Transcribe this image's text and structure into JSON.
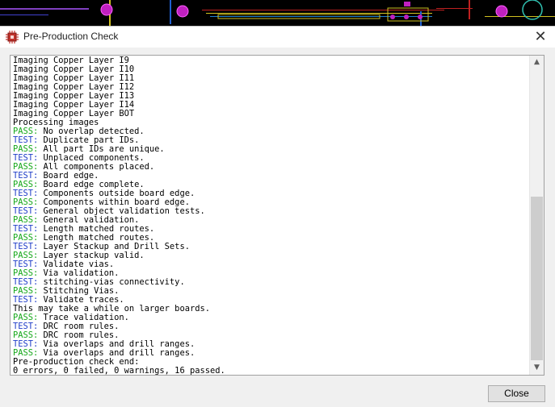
{
  "dialog": {
    "title": "Pre-Production Check",
    "close_button": "Close"
  },
  "colors": {
    "pass": "#16a81a",
    "test": "#1e3cc8",
    "pcb_background": "#000000",
    "pcb_pad": "#c020c0",
    "pcb_trace": "#d0c020"
  },
  "icons": {
    "app": "chip-icon",
    "close": "close-icon",
    "scroll_up": "scroll-up-arrow-icon",
    "scroll_down": "scroll-down-arrow-icon"
  },
  "scroll": {
    "position_fraction": 1.0
  },
  "log": [
    {
      "tag": "",
      "text": "Imaging Copper Layer I9"
    },
    {
      "tag": "",
      "text": "Imaging Copper Layer I10"
    },
    {
      "tag": "",
      "text": "Imaging Copper Layer I11"
    },
    {
      "tag": "",
      "text": "Imaging Copper Layer I12"
    },
    {
      "tag": "",
      "text": "Imaging Copper Layer I13"
    },
    {
      "tag": "",
      "text": "Imaging Copper Layer I14"
    },
    {
      "tag": "",
      "text": "Imaging Copper Layer BOT"
    },
    {
      "tag": "",
      "text": "Processing images"
    },
    {
      "tag": "PASS:",
      "text": " No overlap detected."
    },
    {
      "tag": "TEST:",
      "text": " Duplicate part IDs."
    },
    {
      "tag": "PASS:",
      "text": " All part IDs are unique."
    },
    {
      "tag": "TEST:",
      "text": " Unplaced components."
    },
    {
      "tag": "PASS:",
      "text": " All components placed."
    },
    {
      "tag": "TEST:",
      "text": " Board edge."
    },
    {
      "tag": "PASS:",
      "text": " Board edge complete."
    },
    {
      "tag": "TEST:",
      "text": " Components outside board edge."
    },
    {
      "tag": "PASS:",
      "text": " Components within board edge."
    },
    {
      "tag": "TEST:",
      "text": " General object validation tests."
    },
    {
      "tag": "PASS:",
      "text": " General validation."
    },
    {
      "tag": "TEST:",
      "text": " Length matched routes."
    },
    {
      "tag": "PASS:",
      "text": " Length matched routes."
    },
    {
      "tag": "TEST:",
      "text": " Layer Stackup and Drill Sets."
    },
    {
      "tag": "PASS:",
      "text": " Layer stackup valid."
    },
    {
      "tag": "TEST:",
      "text": " Validate vias."
    },
    {
      "tag": "PASS:",
      "text": " Via validation."
    },
    {
      "tag": "TEST:",
      "text": " stitching-vias connectivity."
    },
    {
      "tag": "PASS:",
      "text": " Stitching Vias."
    },
    {
      "tag": "TEST:",
      "text": " Validate traces."
    },
    {
      "tag": "",
      "text": "This may take a while on larger boards."
    },
    {
      "tag": "PASS:",
      "text": " Trace validation."
    },
    {
      "tag": "TEST:",
      "text": " DRC room rules."
    },
    {
      "tag": "PASS:",
      "text": " DRC room rules."
    },
    {
      "tag": "TEST:",
      "text": " Via overlaps and drill ranges."
    },
    {
      "tag": "PASS:",
      "text": " Via overlaps and drill ranges."
    },
    {
      "tag": "",
      "text": "Pre-production check end:"
    },
    {
      "tag": "",
      "text": "0 errors, 0 failed, 0 warnings, 16 passed."
    }
  ]
}
